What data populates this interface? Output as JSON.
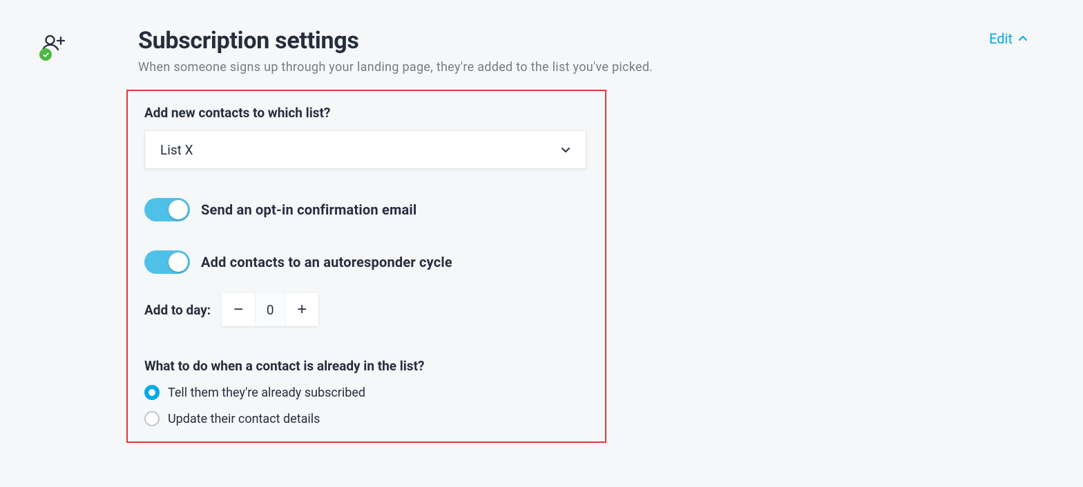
{
  "header": {
    "title": "Subscription settings",
    "subtitle": "When someone signs up through your landing page, they're added to the list you've picked."
  },
  "actions": {
    "edit_label": "Edit"
  },
  "list_selector": {
    "label": "Add new contacts to which list?",
    "value": "List X"
  },
  "toggles": {
    "optin_label": "Send an opt-in confirmation email",
    "optin_on": true,
    "autoresponder_label": "Add contacts to an autoresponder cycle",
    "autoresponder_on": true
  },
  "day_spinner": {
    "label": "Add to day:",
    "value": "0",
    "minus": "−",
    "plus": "+"
  },
  "existing_contact": {
    "heading": "What to do when a contact is already in the list?",
    "option_tell": "Tell them they're already subscribed",
    "option_update": "Update their contact details",
    "selected_index": 0
  }
}
